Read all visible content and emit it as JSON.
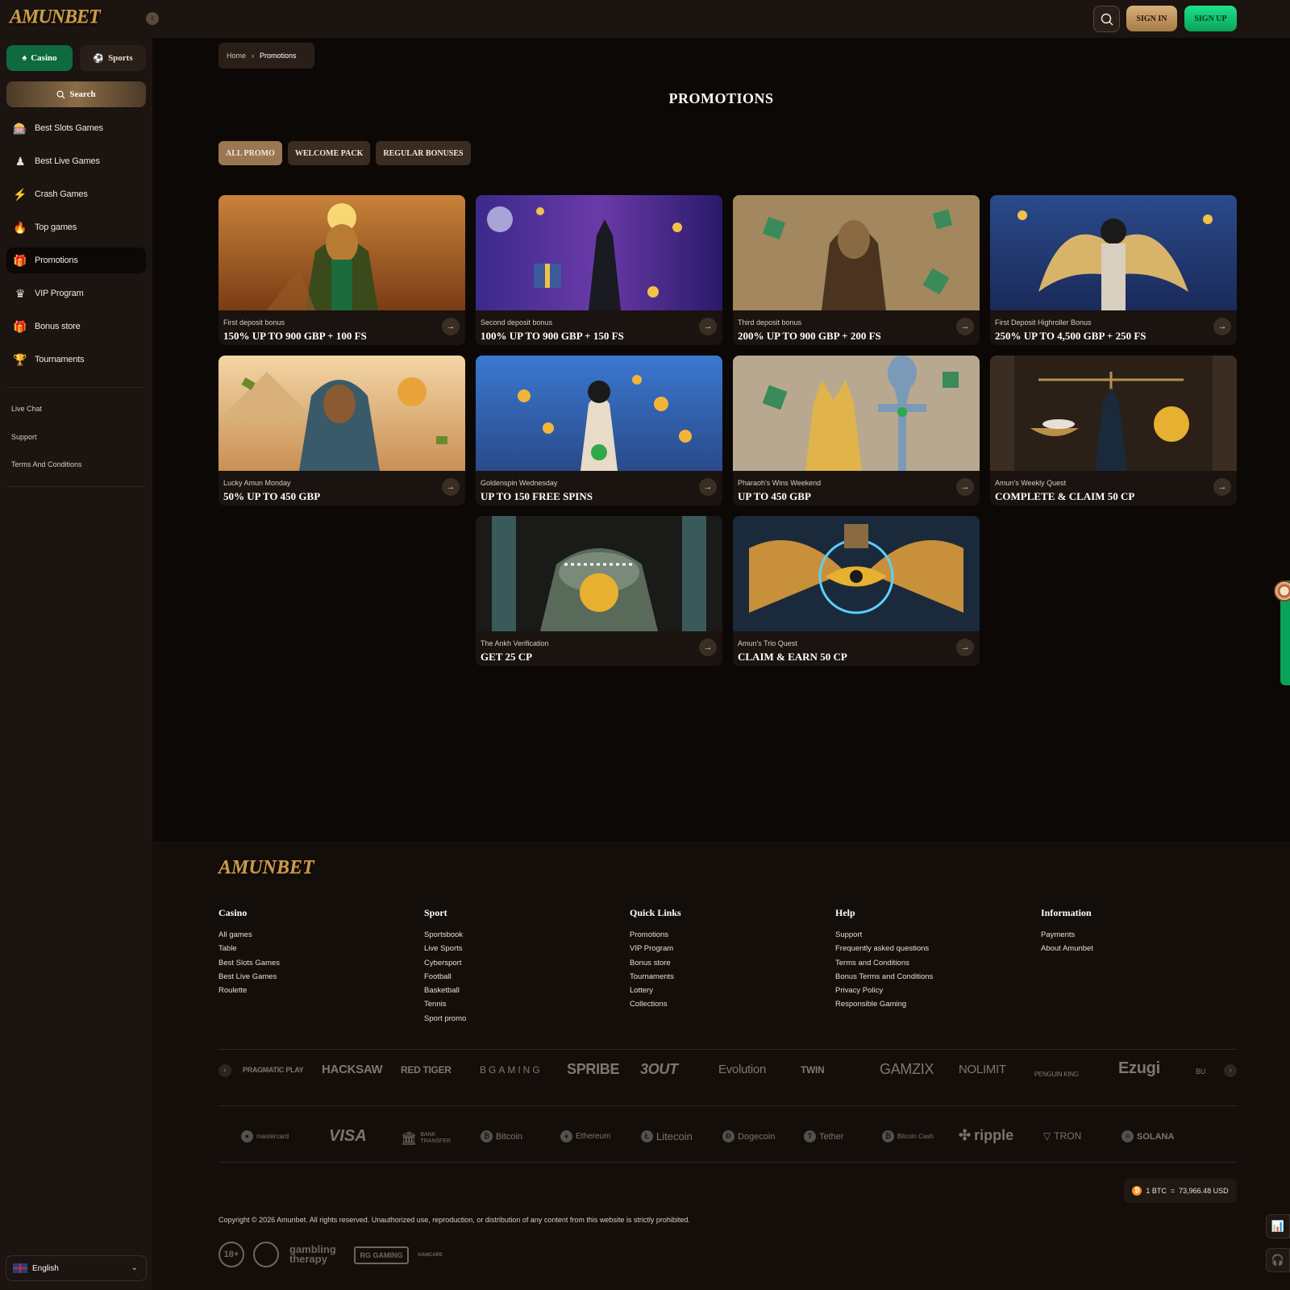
{
  "brand": {
    "logo_text": "AMUNBET"
  },
  "sidebar": {
    "mode_tabs": [
      {
        "label": "Casino"
      },
      {
        "label": "Sports"
      }
    ],
    "search_label": "Search",
    "items": [
      {
        "label": "Best Slots Games",
        "icon": "slots-icon"
      },
      {
        "label": "Best Live Games",
        "icon": "dealer-icon"
      },
      {
        "label": "Crash Games",
        "icon": "lightning-icon"
      },
      {
        "label": "Top games",
        "icon": "flame-icon"
      },
      {
        "label": "Promotions",
        "icon": "gift-icon"
      },
      {
        "label": "VIP Program",
        "icon": "crown-icon"
      },
      {
        "label": "Bonus store",
        "icon": "gift-box-icon"
      },
      {
        "label": "Tournaments",
        "icon": "trophy-icon"
      }
    ],
    "links": [
      "Live Chat",
      "Support",
      "Terms And Conditions"
    ],
    "language": "English"
  },
  "header": {
    "signin": "SIGN IN",
    "signup": "SIGN UP"
  },
  "breadcrumb": {
    "home": "Home",
    "current": "Promotions"
  },
  "page_title": "PROMOTIONS",
  "filters": [
    {
      "label": "ALL PROMO",
      "active": true
    },
    {
      "label": "WELCOME PACK",
      "active": false
    },
    {
      "label": "REGULAR BONUSES",
      "active": false
    }
  ],
  "promos": [
    {
      "caption": "First deposit bonus",
      "title": "150% UP TO 900 GBP + 100 FS"
    },
    {
      "caption": "Second deposit bonus",
      "title": "100% UP TO 900 GBP + 150 FS"
    },
    {
      "caption": "Third deposit bonus",
      "title": "200% UP TO 900 GBP + 200 FS"
    },
    {
      "caption": "First Deposit Highroller Bonus",
      "title": "250% UP TO 4,500 GBP + 250 FS"
    },
    {
      "caption": "Lucky Amun Monday",
      "title": "50% UP TO 450 GBP"
    },
    {
      "caption": "Goldenspin Wednesday",
      "title": "UP TO 150 FREE SPINS"
    },
    {
      "caption": "Pharaoh's Wins Weekend",
      "title": "UP TO 450 GBP"
    },
    {
      "caption": "Amun's Weekly Quest",
      "title": "COMPLETE & CLAIM 50 CP"
    },
    {
      "caption": "The Ankh Verification",
      "title": "GET 25 CP"
    },
    {
      "caption": "Amun's Trio Quest",
      "title": "CLAIM & EARN 50 CP"
    }
  ],
  "footer": {
    "columns": [
      {
        "title": "Casino",
        "links": [
          "All games",
          "Table",
          "Best Slots Games",
          "Best Live Games",
          "Roulette"
        ]
      },
      {
        "title": "Sport",
        "links": [
          "Sportsbook",
          "Live Sports",
          "Cybersport",
          "Football",
          "Basketball",
          "Tennis",
          "Sport promo"
        ]
      },
      {
        "title": "Quick Links",
        "links": [
          "Promotions",
          "VIP Program",
          "Bonus store",
          "Tournaments",
          "Lottery",
          "Collections"
        ]
      },
      {
        "title": "Help",
        "links": [
          "Support",
          "Frequently asked questions",
          "Terms and Conditions",
          "Bonus Terms and Conditions",
          "Privacy Policy",
          "Responsible Gaming"
        ]
      },
      {
        "title": "Information",
        "links": [
          "Payments",
          "About Amunbet"
        ]
      }
    ],
    "providers": [
      "PRAGMATIC PLAY",
      "HACKSAW",
      "RED TIGER",
      "BGAMING",
      "SPRIBE",
      "3OUT",
      "Evolution",
      "TWIN",
      "GAMZIX",
      "NOLIMIT",
      "PENGUIN KING",
      "Ezugi",
      "BU"
    ],
    "payments": [
      "mastercard",
      "VISA",
      "BANK TRANSFER",
      "Bitcoin",
      "Ethereum",
      "Litecoin",
      "Dogecoin",
      "Tether",
      "Bitcoin Cash",
      "ripple",
      "TRON",
      "SOLANA"
    ],
    "rate": "1 BTC  =  73,966.48 USD",
    "copyright": "Copyright © 2026 Amunbet. All rights reserved. Unauthorized use, reproduction, or distribution of any content from this website is strictly prohibited.",
    "badges": [
      "18+",
      "gambling therapy",
      "RG GAMING",
      "GAMCARE"
    ]
  }
}
